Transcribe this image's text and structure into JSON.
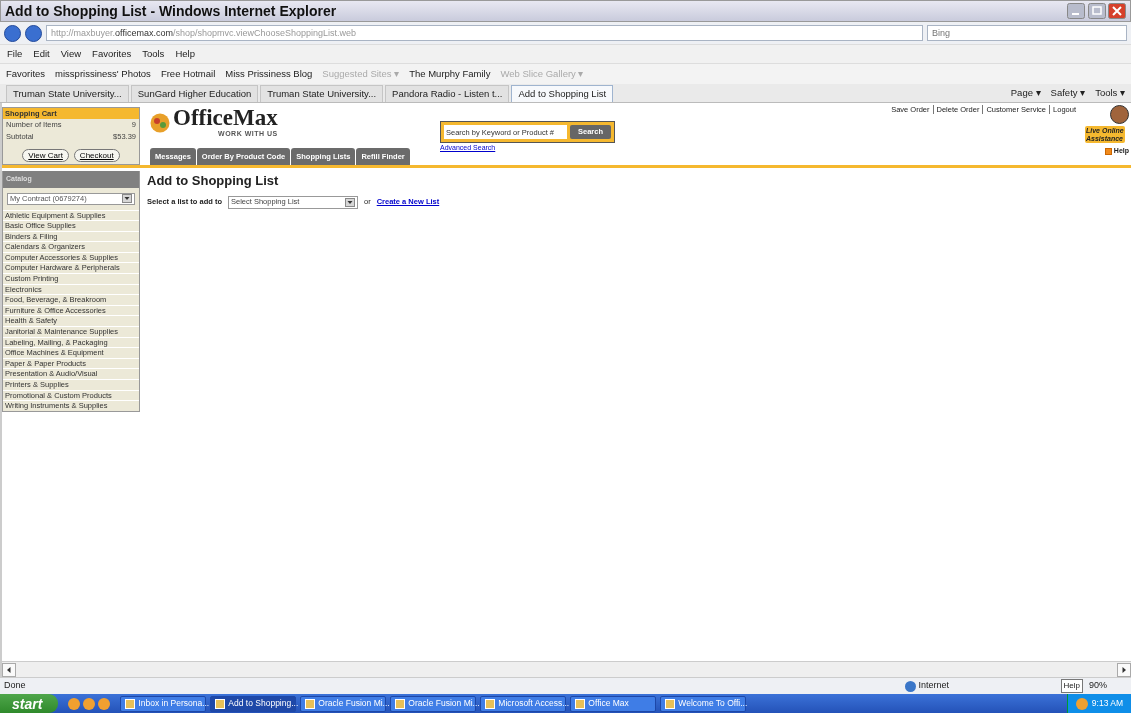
{
  "window": {
    "title": "Add to Shopping List - Windows Internet Explorer"
  },
  "address": {
    "url": "http://maxbuyer.**officemax.com**/shop/shopmvc.viewChooseShoppingList.web",
    "search_placeholder": "Bing"
  },
  "menu": [
    "File",
    "Edit",
    "View",
    "Favorites",
    "Tools",
    "Help"
  ],
  "favorites_bar": [
    {
      "label": "Favorites",
      "disabled": false
    },
    {
      "label": "missprissiness' Photos",
      "disabled": false
    },
    {
      "label": "Free Hotmail",
      "disabled": false
    },
    {
      "label": "Miss Prissiness Blog",
      "disabled": false
    },
    {
      "label": "Suggested Sites ▾",
      "disabled": true
    },
    {
      "label": "The Murphy Family",
      "disabled": false
    },
    {
      "label": "Web Slice Gallery ▾",
      "disabled": true
    }
  ],
  "tabs": [
    {
      "label": "Truman State University...",
      "selected": false
    },
    {
      "label": "SunGard Higher Education",
      "selected": false
    },
    {
      "label": "Truman State University...",
      "selected": false
    },
    {
      "label": "Pandora Radio - Listen t...",
      "selected": false
    },
    {
      "label": "Add to Shopping List",
      "selected": true
    }
  ],
  "command_bar": [
    "Page ▾",
    "Safety ▾",
    "Tools ▾"
  ],
  "page": {
    "cart": {
      "title": "Shopping Cart",
      "rows": [
        {
          "label": "Number of Items",
          "value": "9"
        },
        {
          "label": "Subtotal",
          "value": "$53.39"
        }
      ],
      "buttons": [
        "View Cart",
        "Checkout"
      ]
    },
    "logo": {
      "name": "OfficeMax",
      "tagline": "WORK WITH US"
    },
    "nav_tabs": [
      "Messages",
      "Order By Product Code",
      "Shopping Lists",
      "Refill Finder"
    ],
    "search": {
      "placeholder": "Search by Keyword or Product #",
      "button": "Search",
      "advanced_link": "Advanced Search"
    },
    "top_links": [
      "Save Order",
      "Delete Order",
      "Customer Service",
      "Logout"
    ],
    "live_assistance": "Live Online Assistance",
    "help": "Help",
    "catalog": {
      "title": "Catalog",
      "contract": "My Contract (0679274)",
      "items": [
        "Athletic Equipment & Supplies",
        "Basic Office Supplies",
        "Binders & Filing",
        "Calendars & Organizers",
        "Computer Accessories & Supplies",
        "Computer Hardware & Peripherals",
        "Custom Printing",
        "Electronics",
        "Food, Beverage, & Breakroom",
        "Furniture & Office Accessories",
        "Health & Safety",
        "Janitorial & Maintenance Supplies",
        "Labeling, Mailing, & Packaging",
        "Office Machines & Equipment",
        "Paper & Paper Products",
        "Presentation & Audio/Visual",
        "Printers & Supplies",
        "Promotional & Custom Products",
        "Writing Instruments & Supplies"
      ]
    },
    "main": {
      "heading": "Add to Shopping List",
      "label": "Select a list to add to",
      "select_value": "Select Shopping List",
      "or_text": "or",
      "link": "Create a New List"
    }
  },
  "status_bar": {
    "text": "Done",
    "zone": "Internet",
    "help": "Help",
    "zoom": "90%"
  },
  "taskbar": {
    "start": "start",
    "items": [
      {
        "label": "Inbox in Persona...",
        "selected": false
      },
      {
        "label": "Add to Shopping...",
        "selected": true
      },
      {
        "label": "Oracle Fusion Mi...",
        "selected": false
      },
      {
        "label": "Oracle Fusion Mi...",
        "selected": false
      },
      {
        "label": "Microsoft Access...",
        "selected": false
      },
      {
        "label": "Office Max",
        "selected": false
      },
      {
        "label": "Welcome To Offi...",
        "selected": false
      }
    ],
    "clock": "9:13 AM"
  }
}
